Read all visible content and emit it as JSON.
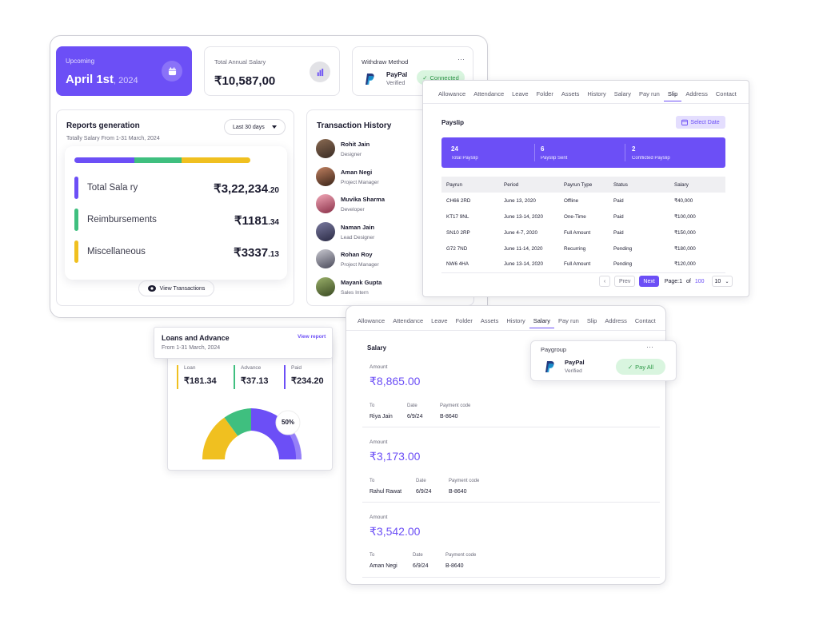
{
  "upcoming": {
    "label": "Upcoming",
    "date": "April 1st",
    "year": ", 2024"
  },
  "annual_salary": {
    "label": "Total Annual Salary",
    "value": "₹10,587,00"
  },
  "withdraw": {
    "label": "Withdraw Method",
    "menu": "···",
    "method": "PayPal",
    "status": "Verified",
    "badge": "Connected"
  },
  "reports": {
    "title": "Reports generation",
    "subtitle": "Totally Salary From 1-31 March, 2024",
    "range": "Last 30 days",
    "progress": [
      0.34,
      0.27,
      0.39
    ],
    "colors": {
      "primary": "#6c4ff6",
      "green": "#3fbf7f",
      "yellow": "#f0c020"
    },
    "items": [
      {
        "label": "Total Sala ry",
        "value": "₹3,22,234",
        "decimal": ".20"
      },
      {
        "label": "Reimbursements",
        "value": "₹1181",
        "decimal": ".34"
      },
      {
        "label": "Miscellaneous",
        "value": "₹3337",
        "decimal": ".13"
      }
    ],
    "view_button": "View Transactions"
  },
  "transactions": {
    "title": "Transaction History",
    "people": [
      {
        "name": "Rohit Jain",
        "role": "Designer"
      },
      {
        "name": "Aman Negi",
        "role": "Project Manager"
      },
      {
        "name": "Muvika Sharma",
        "role": "Developer"
      },
      {
        "name": "Naman Jain",
        "role": "Lead Designer"
      },
      {
        "name": "Rohan Roy",
        "role": "Project Manager"
      },
      {
        "name": "Mayank Gupta",
        "role": "Sales Intern"
      }
    ]
  },
  "payslip": {
    "tabs": [
      "Allowance",
      "Attendance",
      "Leave",
      "Folder",
      "Assets",
      "History",
      "Salary",
      "Pay run",
      "Slip",
      "Address",
      "Contact"
    ],
    "active_tab": "Slip",
    "title": "Payslip",
    "select_date": "Select Date",
    "stats": [
      {
        "value": "24",
        "label": "Total Payslip"
      },
      {
        "value": "6",
        "label": "Payslip Sent"
      },
      {
        "value": "2",
        "label": "Conflicted Payslip"
      }
    ],
    "columns": [
      "Payrun",
      "Period",
      "Payrun Type",
      "Status",
      "Salary"
    ],
    "rows": [
      [
        "CH66 2RD",
        "June 13, 2020",
        "Offline",
        "Paid",
        "₹40,000"
      ],
      [
        "KT17 9NL",
        "June 13-14, 2020",
        "One-Time",
        "Paid",
        "₹100,000"
      ],
      [
        "SN10 2RP",
        "June 4-7, 2020",
        "Full Amount",
        "Paid",
        "₹150,000"
      ],
      [
        "G72 7ND",
        "June 11-14, 2020",
        "Recurring",
        "Pending",
        "₹180,000"
      ],
      [
        "NW6 4HA",
        "June 13-14, 2020",
        "Full Amount",
        "Pending",
        "₹120,000"
      ]
    ],
    "pagination": {
      "prev": "Prev",
      "next": "Next",
      "page_label": "Page:1",
      "of": "of",
      "total": "100",
      "per_page": "10"
    }
  },
  "loans": {
    "title": "Loans and Advance",
    "subtitle": "From 1-31 March, 2024",
    "view": "View report",
    "stats": [
      {
        "label": "Loan",
        "value": "₹181.34"
      },
      {
        "label": "Advance",
        "value": "₹37.13"
      },
      {
        "label": "Paid",
        "value": "₹234.20"
      }
    ],
    "gauge_percent": "50%",
    "gauge_shares": [
      0.4,
      0.15,
      0.45
    ]
  },
  "salary_panel": {
    "tabs": [
      "Allowance",
      "Attendance",
      "Leave",
      "Folder",
      "Assets",
      "History",
      "Salary",
      "Pay run",
      "Slip",
      "Address",
      "Contact"
    ],
    "active_tab": "Salary",
    "title": "Salary",
    "entries": [
      {
        "amount_label": "Amount",
        "amount": "₹8,865.00",
        "to_label": "To",
        "to": "Riya Jain",
        "date_label": "Date",
        "date": "6/9/24",
        "code_label": "Payment code",
        "code": "B-8640"
      },
      {
        "amount_label": "Amount",
        "amount": "₹3,173.00",
        "to_label": "To",
        "to": "Rahul Rawat",
        "date_label": "Date",
        "date": "6/9/24",
        "code_label": "Payment code",
        "code": "B-8640"
      },
      {
        "amount_label": "Amount",
        "amount": "₹3,542.00",
        "to_label": "To",
        "to": "Aman Negi",
        "date_label": "Date",
        "date": "6/9/24",
        "code_label": "Payment code",
        "code": "B-8640"
      }
    ]
  },
  "paygroup": {
    "label": "Paygroup",
    "menu": "···",
    "method": "PayPal",
    "status": "Verified",
    "button": "Pay All"
  }
}
